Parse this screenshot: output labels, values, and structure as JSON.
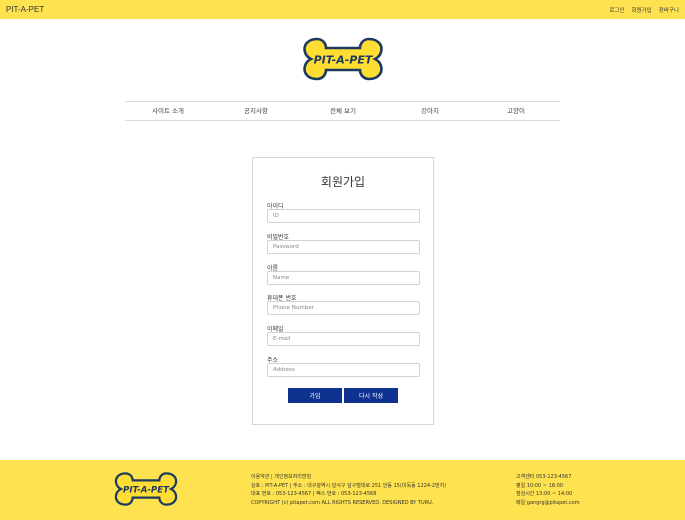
{
  "topbar": {
    "brand": "PIT-A-PET",
    "links": [
      "로그인",
      "회원가입",
      "장바구니"
    ]
  },
  "logo": {
    "text": "PIT-A-PET"
  },
  "nav": {
    "items": [
      "사이트 소개",
      "공지사항",
      "전체 보기",
      "강아지",
      "고양이"
    ]
  },
  "form": {
    "title": "회원가입",
    "fields": [
      {
        "label": "아이디",
        "placeholder": "ID"
      },
      {
        "label": "비밀번호",
        "placeholder": "Password"
      },
      {
        "label": "이름",
        "placeholder": "Name"
      },
      {
        "label": "휴대폰 번호",
        "placeholder": "Phone Number"
      },
      {
        "label": "이메일",
        "placeholder": "E-mail"
      },
      {
        "label": "주소",
        "placeholder": "Address"
      }
    ],
    "submit_label": "가입",
    "reset_label": "다시 작성"
  },
  "footer": {
    "logo_text": "PIT-A-PET",
    "info": [
      "이용약관 | 개인정보처리방침",
      "상호 : PIT-A-PET | 주소 : 대구광역시 달서구 달구벌대로 251 안동 15(미독동 1224-2번지)",
      "대표 번호 : 053-123-4567 | 팩스 번호 : 053-123-4568",
      "COPYRIGHT (c) pitapet.com ALL RIGHTS RESERVED. DESIGNED BY TURU."
    ],
    "contact": [
      "고객센터 053-123-4567",
      "평일 10:00 ~ 18:00",
      "점심시간 13:00 ~ 14:00",
      "메일 gangrg@pitapet.com"
    ]
  },
  "colors": {
    "accent_yellow": "#ffe24f",
    "button_blue": "#0f3290",
    "logo_fill": "#ffdd33",
    "logo_stroke": "#1c3a5f"
  }
}
